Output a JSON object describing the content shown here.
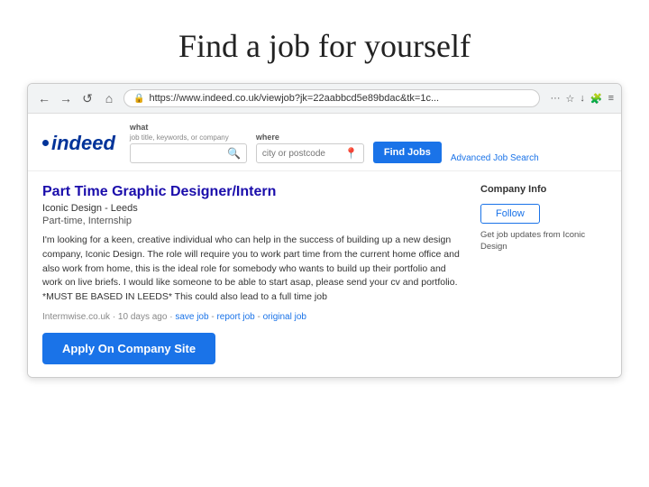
{
  "page": {
    "title": "Find a job for yourself"
  },
  "browser": {
    "url": "https://www.indeed.co.uk/viewjob?jk=22aabbcd5e89bdac&tk=1c...",
    "nav": {
      "back": "←",
      "forward": "→",
      "refresh": "↺",
      "home": "⌂"
    },
    "actions": {
      "more": "···",
      "star": "☆",
      "download": "↓",
      "extensions": "🧩",
      "menu": "≡"
    }
  },
  "indeed": {
    "logo": "indeed",
    "search": {
      "what_label": "what",
      "what_sublabel": "job title, keywords, or company",
      "what_placeholder": "",
      "where_label": "where",
      "where_placeholder": "city or postcode",
      "find_jobs_label": "Find Jobs",
      "advanced_label": "Advanced Job Search"
    }
  },
  "job": {
    "title": "Part Time Graphic Designer/Intern",
    "company": "Iconic Design  -  Leeds",
    "type": "Part-time, Internship",
    "description": "I'm looking for a keen, creative individual who can help in the success of building up a new design company, Iconic Design. The role will require you to work part time from the current home office and also work from home, this is the ideal role for somebody who wants to build up their portfolio and work on live briefs. I would like someone to be able to start asap, please send your cv and portfolio. *MUST BE BASED IN LEEDS* This could also lead to a full time job",
    "footer": {
      "source": "Intermwise.co.uk",
      "time": "10 days ago",
      "save": "save job",
      "report": "report job",
      "original": "original job"
    },
    "apply_label": "Apply On Company Site"
  },
  "company_info": {
    "title": "Company Info",
    "follow_label": "Follow",
    "updates_text": "Get job updates from Iconic Design"
  }
}
